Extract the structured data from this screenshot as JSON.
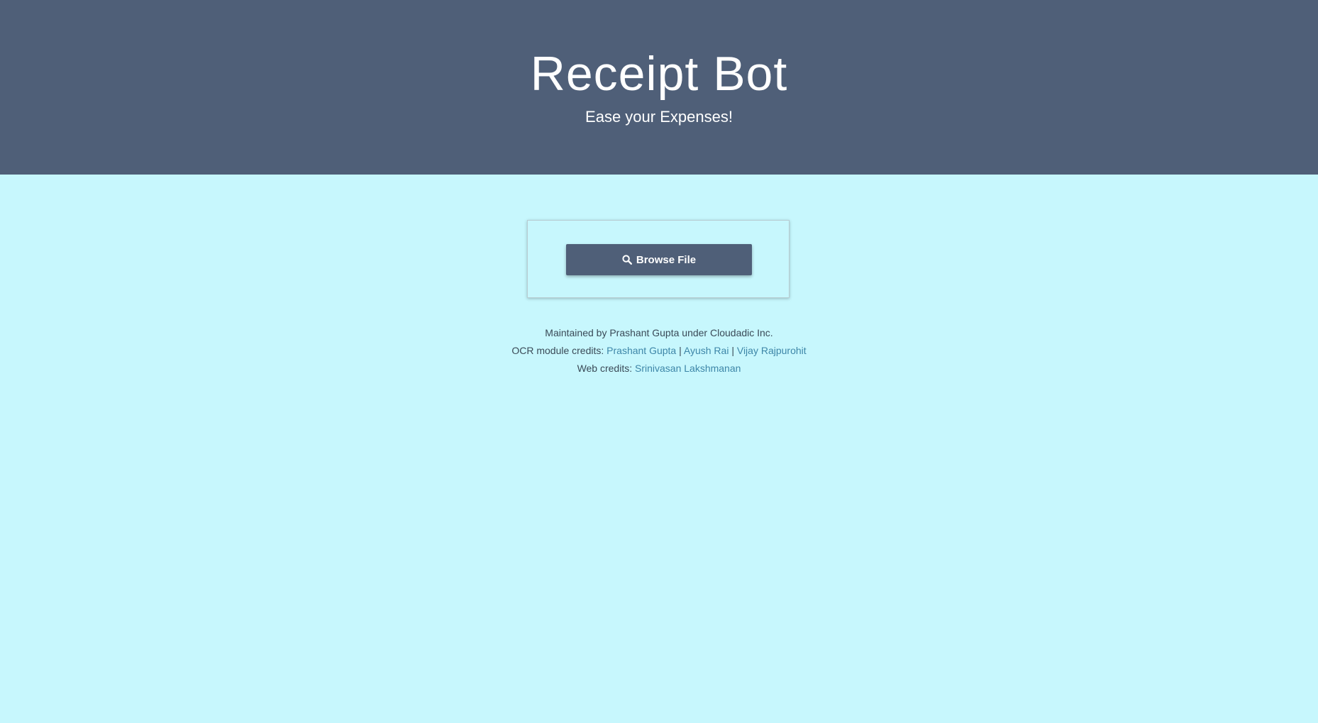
{
  "header": {
    "title": "Receipt Bot",
    "subtitle": "Ease your Expenses!"
  },
  "upload": {
    "browse_label": "Browse File",
    "icon": "search-icon"
  },
  "credits": {
    "maintained": "Maintained by Prashant Gupta under Cloudadic Inc.",
    "ocr_prefix": "OCR module credits:",
    "ocr_names": [
      "Prashant Gupta",
      "Ayush Rai",
      "Vijay Rajpurohit"
    ],
    "separator": "|",
    "web_prefix": "Web credits:",
    "web_name": "Srinivasan Lakshmanan"
  },
  "colors": {
    "header_bg": "#4f5f78",
    "page_bg": "#c7f7fd",
    "link": "#3d86a8"
  }
}
